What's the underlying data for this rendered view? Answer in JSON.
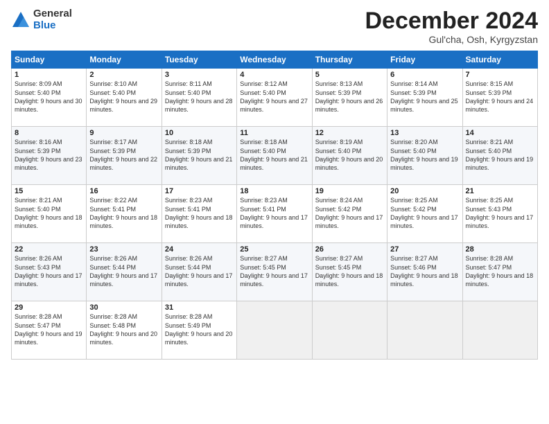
{
  "logo": {
    "general": "General",
    "blue": "Blue"
  },
  "header": {
    "month": "December 2024",
    "location": "Gul'cha, Osh, Kyrgyzstan"
  },
  "weekdays": [
    "Sunday",
    "Monday",
    "Tuesday",
    "Wednesday",
    "Thursday",
    "Friday",
    "Saturday"
  ],
  "weeks": [
    [
      {
        "day": "1",
        "sunrise": "Sunrise: 8:09 AM",
        "sunset": "Sunset: 5:40 PM",
        "daylight": "Daylight: 9 hours and 30 minutes."
      },
      {
        "day": "2",
        "sunrise": "Sunrise: 8:10 AM",
        "sunset": "Sunset: 5:40 PM",
        "daylight": "Daylight: 9 hours and 29 minutes."
      },
      {
        "day": "3",
        "sunrise": "Sunrise: 8:11 AM",
        "sunset": "Sunset: 5:40 PM",
        "daylight": "Daylight: 9 hours and 28 minutes."
      },
      {
        "day": "4",
        "sunrise": "Sunrise: 8:12 AM",
        "sunset": "Sunset: 5:40 PM",
        "daylight": "Daylight: 9 hours and 27 minutes."
      },
      {
        "day": "5",
        "sunrise": "Sunrise: 8:13 AM",
        "sunset": "Sunset: 5:39 PM",
        "daylight": "Daylight: 9 hours and 26 minutes."
      },
      {
        "day": "6",
        "sunrise": "Sunrise: 8:14 AM",
        "sunset": "Sunset: 5:39 PM",
        "daylight": "Daylight: 9 hours and 25 minutes."
      },
      {
        "day": "7",
        "sunrise": "Sunrise: 8:15 AM",
        "sunset": "Sunset: 5:39 PM",
        "daylight": "Daylight: 9 hours and 24 minutes."
      }
    ],
    [
      {
        "day": "8",
        "sunrise": "Sunrise: 8:16 AM",
        "sunset": "Sunset: 5:39 PM",
        "daylight": "Daylight: 9 hours and 23 minutes."
      },
      {
        "day": "9",
        "sunrise": "Sunrise: 8:17 AM",
        "sunset": "Sunset: 5:39 PM",
        "daylight": "Daylight: 9 hours and 22 minutes."
      },
      {
        "day": "10",
        "sunrise": "Sunrise: 8:18 AM",
        "sunset": "Sunset: 5:39 PM",
        "daylight": "Daylight: 9 hours and 21 minutes."
      },
      {
        "day": "11",
        "sunrise": "Sunrise: 8:18 AM",
        "sunset": "Sunset: 5:40 PM",
        "daylight": "Daylight: 9 hours and 21 minutes."
      },
      {
        "day": "12",
        "sunrise": "Sunrise: 8:19 AM",
        "sunset": "Sunset: 5:40 PM",
        "daylight": "Daylight: 9 hours and 20 minutes."
      },
      {
        "day": "13",
        "sunrise": "Sunrise: 8:20 AM",
        "sunset": "Sunset: 5:40 PM",
        "daylight": "Daylight: 9 hours and 19 minutes."
      },
      {
        "day": "14",
        "sunrise": "Sunrise: 8:21 AM",
        "sunset": "Sunset: 5:40 PM",
        "daylight": "Daylight: 9 hours and 19 minutes."
      }
    ],
    [
      {
        "day": "15",
        "sunrise": "Sunrise: 8:21 AM",
        "sunset": "Sunset: 5:40 PM",
        "daylight": "Daylight: 9 hours and 18 minutes."
      },
      {
        "day": "16",
        "sunrise": "Sunrise: 8:22 AM",
        "sunset": "Sunset: 5:41 PM",
        "daylight": "Daylight: 9 hours and 18 minutes."
      },
      {
        "day": "17",
        "sunrise": "Sunrise: 8:23 AM",
        "sunset": "Sunset: 5:41 PM",
        "daylight": "Daylight: 9 hours and 18 minutes."
      },
      {
        "day": "18",
        "sunrise": "Sunrise: 8:23 AM",
        "sunset": "Sunset: 5:41 PM",
        "daylight": "Daylight: 9 hours and 17 minutes."
      },
      {
        "day": "19",
        "sunrise": "Sunrise: 8:24 AM",
        "sunset": "Sunset: 5:42 PM",
        "daylight": "Daylight: 9 hours and 17 minutes."
      },
      {
        "day": "20",
        "sunrise": "Sunrise: 8:25 AM",
        "sunset": "Sunset: 5:42 PM",
        "daylight": "Daylight: 9 hours and 17 minutes."
      },
      {
        "day": "21",
        "sunrise": "Sunrise: 8:25 AM",
        "sunset": "Sunset: 5:43 PM",
        "daylight": "Daylight: 9 hours and 17 minutes."
      }
    ],
    [
      {
        "day": "22",
        "sunrise": "Sunrise: 8:26 AM",
        "sunset": "Sunset: 5:43 PM",
        "daylight": "Daylight: 9 hours and 17 minutes."
      },
      {
        "day": "23",
        "sunrise": "Sunrise: 8:26 AM",
        "sunset": "Sunset: 5:44 PM",
        "daylight": "Daylight: 9 hours and 17 minutes."
      },
      {
        "day": "24",
        "sunrise": "Sunrise: 8:26 AM",
        "sunset": "Sunset: 5:44 PM",
        "daylight": "Daylight: 9 hours and 17 minutes."
      },
      {
        "day": "25",
        "sunrise": "Sunrise: 8:27 AM",
        "sunset": "Sunset: 5:45 PM",
        "daylight": "Daylight: 9 hours and 17 minutes."
      },
      {
        "day": "26",
        "sunrise": "Sunrise: 8:27 AM",
        "sunset": "Sunset: 5:45 PM",
        "daylight": "Daylight: 9 hours and 18 minutes."
      },
      {
        "day": "27",
        "sunrise": "Sunrise: 8:27 AM",
        "sunset": "Sunset: 5:46 PM",
        "daylight": "Daylight: 9 hours and 18 minutes."
      },
      {
        "day": "28",
        "sunrise": "Sunrise: 8:28 AM",
        "sunset": "Sunset: 5:47 PM",
        "daylight": "Daylight: 9 hours and 18 minutes."
      }
    ],
    [
      {
        "day": "29",
        "sunrise": "Sunrise: 8:28 AM",
        "sunset": "Sunset: 5:47 PM",
        "daylight": "Daylight: 9 hours and 19 minutes."
      },
      {
        "day": "30",
        "sunrise": "Sunrise: 8:28 AM",
        "sunset": "Sunset: 5:48 PM",
        "daylight": "Daylight: 9 hours and 20 minutes."
      },
      {
        "day": "31",
        "sunrise": "Sunrise: 8:28 AM",
        "sunset": "Sunset: 5:49 PM",
        "daylight": "Daylight: 9 hours and 20 minutes."
      },
      null,
      null,
      null,
      null
    ]
  ]
}
